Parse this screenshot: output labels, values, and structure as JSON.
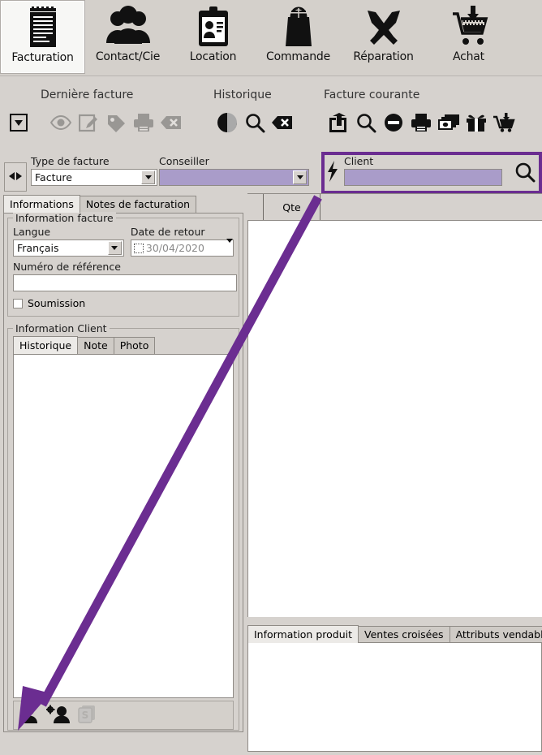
{
  "ribbon": {
    "items": [
      {
        "label": "Facturation",
        "icon": "invoice-pad-icon",
        "active": true
      },
      {
        "label": "Contact/Cie",
        "icon": "people-group-icon",
        "active": false
      },
      {
        "label": "Location",
        "icon": "id-badge-icon",
        "active": false
      },
      {
        "label": "Commande",
        "icon": "shopping-bag-icon",
        "active": false
      },
      {
        "label": "Réparation",
        "icon": "wrench-screwdriver-icon",
        "active": false
      },
      {
        "label": "Achat",
        "icon": "cart-download-icon",
        "active": false
      }
    ]
  },
  "toolbar": {
    "groups": [
      {
        "title": "Dernière facture"
      },
      {
        "title": "Historique"
      },
      {
        "title": "Facture courante"
      }
    ],
    "dropdown_icon": "dropdown-arrow-button",
    "last_invoice_icons": [
      "eye-view-icon",
      "edit-note-icon",
      "tag-icon",
      "printer-icon",
      "clear-tag-icon"
    ],
    "history_icons": [
      "pie-chart-icon",
      "magnifier-icon",
      "clear-tag-icon"
    ],
    "current_invoice_icons": [
      "share-export-icon",
      "magnifier-icon",
      "minus-circle-icon",
      "printer-icon",
      "cash-stack-icon",
      "gift-icon",
      "cart-download-icon"
    ]
  },
  "header_fields": {
    "splitter_icon": "left-right-arrow-icon",
    "type_facture": {
      "label": "Type de facture",
      "value": "Facture"
    },
    "conseiller": {
      "label": "Conseiller",
      "value": ""
    },
    "client": {
      "label": "Client",
      "value": "",
      "bolt_icon": "lightning-bolt-icon",
      "search_icon": "magnifier-icon"
    }
  },
  "left_panel": {
    "tabs": [
      {
        "label": "Informations",
        "selected": true
      },
      {
        "label": "Notes de facturation",
        "selected": false
      }
    ],
    "information_facture": {
      "title": "Information facture",
      "langue": {
        "label": "Langue",
        "value": "Français"
      },
      "date_retour": {
        "label": "Date de retour",
        "value": "30/04/2020",
        "checked": false
      },
      "numero_reference": {
        "label": "Numéro de référence",
        "value": ""
      },
      "soumission": {
        "label": "Soumission",
        "checked": false
      }
    },
    "information_client": {
      "title": "Information Client",
      "tabs": [
        {
          "label": "Historique",
          "selected": true
        },
        {
          "label": "Note",
          "selected": false
        },
        {
          "label": "Photo",
          "selected": false
        }
      ],
      "content": ""
    },
    "status_icons": [
      "person-icon",
      "person-settings-icon",
      "money-note-icon"
    ]
  },
  "main_grid": {
    "columns": [
      "",
      "Qte",
      ""
    ],
    "rows": []
  },
  "bottom_tabs": [
    {
      "label": "Information produit",
      "selected": true
    },
    {
      "label": "Ventes croisées",
      "selected": false
    },
    {
      "label": "Attributs vendables",
      "selected": false
    }
  ],
  "annotation": {
    "highlight_color": "#6b2d91",
    "arrow_color": "#6b2d91",
    "arrow_from": "client-field",
    "arrow_to": "person-icon"
  }
}
